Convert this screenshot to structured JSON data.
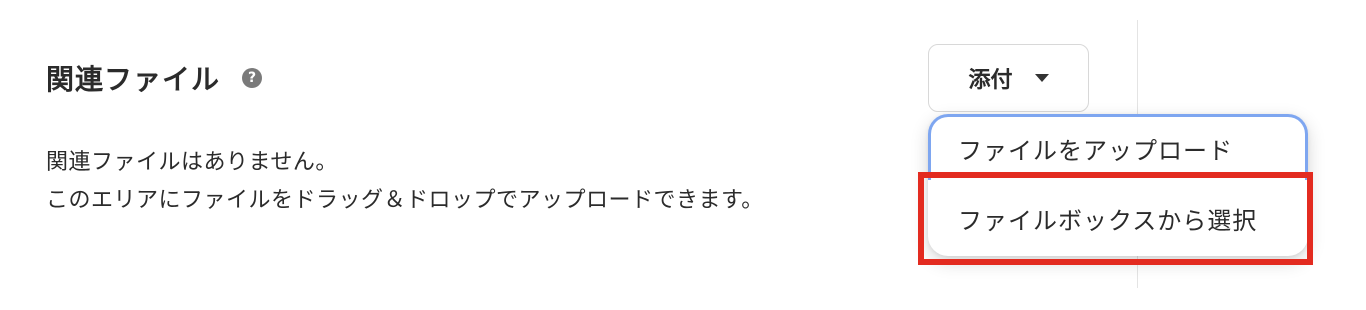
{
  "section": {
    "title": "関連ファイル",
    "help_icon_glyph": "?"
  },
  "empty_state": {
    "line1": "関連ファイルはありません。",
    "line2": "このエリアにファイルをドラッグ＆ドロップでアップロードできます。"
  },
  "attach_button": {
    "label": "添付"
  },
  "dropdown": {
    "items": [
      {
        "label": "ファイルをアップロード"
      },
      {
        "label": "ファイルボックスから選択"
      }
    ]
  },
  "colors": {
    "focus_ring": "#7ea6f0",
    "highlight": "#e32b20",
    "help_icon": "#7a7a7a"
  }
}
